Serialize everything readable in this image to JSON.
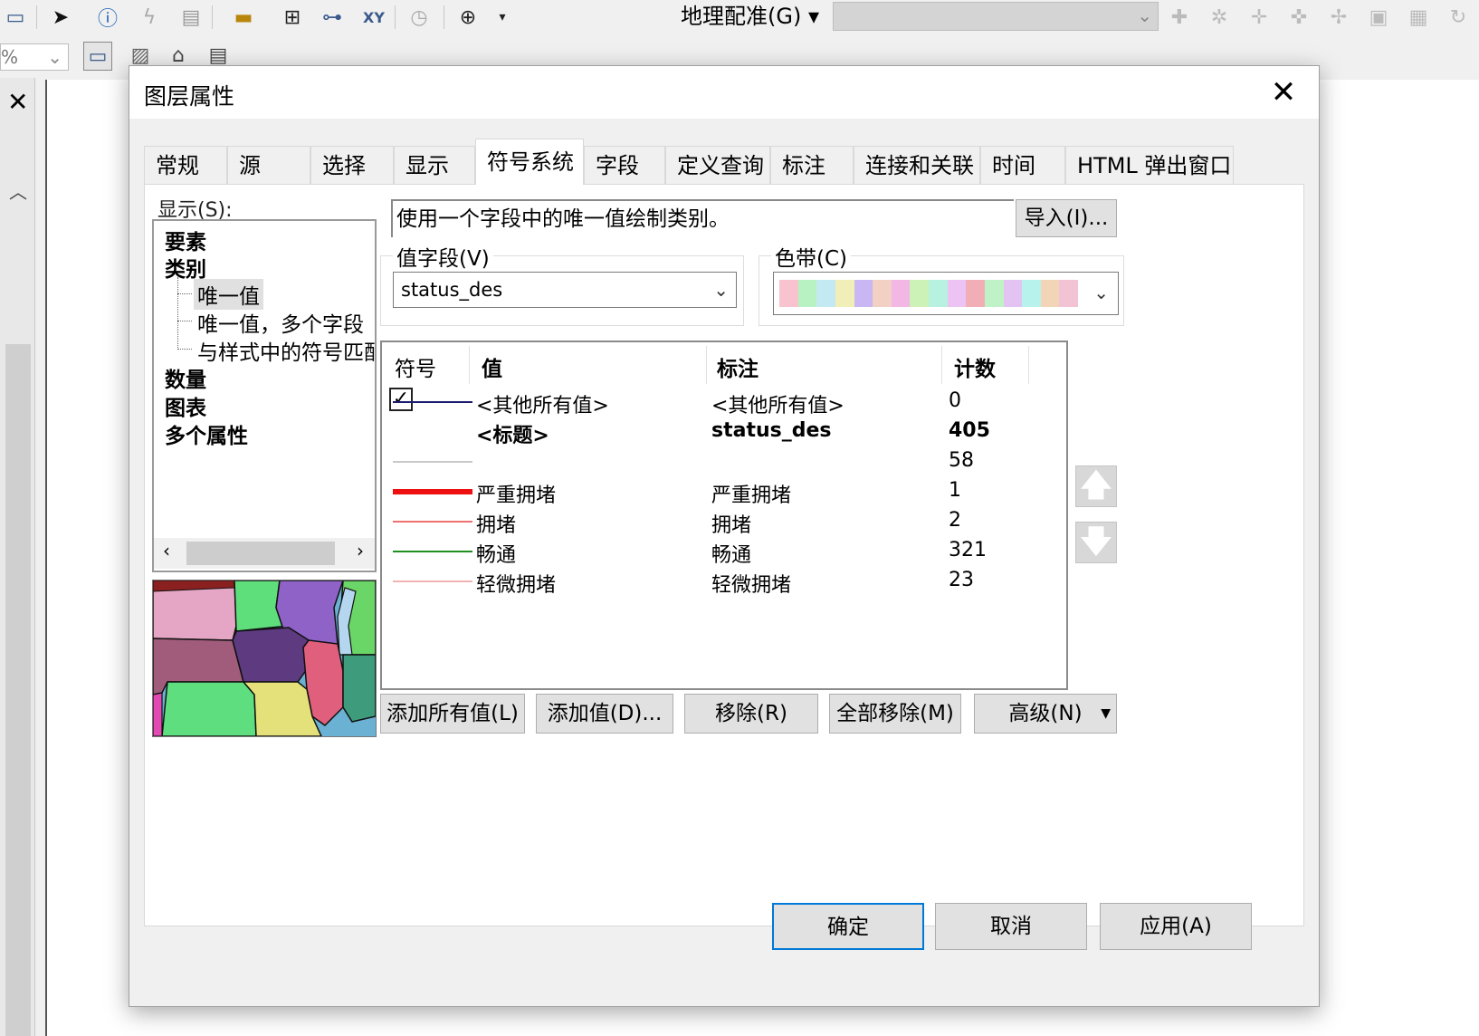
{
  "app": {
    "georef_menu": "地理配准(G) ▾",
    "zoom_percent": "%"
  },
  "dialog": {
    "title": "图层属性",
    "close_glyph": "✕",
    "tabs": [
      "常规",
      "源",
      "选择",
      "显示",
      "符号系统",
      "字段",
      "定义查询",
      "标注",
      "连接和关联",
      "时间",
      "HTML 弹出窗口"
    ],
    "active_tab": "符号系统",
    "show_label": "显示(S):",
    "tree": {
      "features": "要素",
      "categories": "类别",
      "unique_values": "唯一值",
      "unique_values_many": "唯一值，多个字段",
      "match_style": "与样式中的符号匹配",
      "quantities": "数量",
      "charts": "图表",
      "multiple_attributes": "多个属性"
    },
    "description": "使用一个字段中的唯一值绘制类别。",
    "import_button": "导入(I)...",
    "value_field": {
      "label": "值字段(V)",
      "selected": "status_des"
    },
    "color_ramp": {
      "label": "色带(C)",
      "colors": [
        "#f9c2cf",
        "#b8f2c3",
        "#c3eaf2",
        "#f2eeb7",
        "#c8b7f2",
        "#f2d0c3",
        "#f2b7e4",
        "#cdf2b7",
        "#b7f2e0",
        "#ecc3f2",
        "#f2aeb7",
        "#bff2c6",
        "#e2c3f2",
        "#b7f2ec",
        "#f2d4b7",
        "#f2c3d4"
      ]
    },
    "table": {
      "headers": {
        "symbol": "符号",
        "value": "值",
        "label": "标注",
        "count": "计数"
      },
      "rows": [
        {
          "value": "<其他所有值>",
          "label": "<其他所有值>",
          "count": "0",
          "line_color": "#1c1c6e",
          "line_width": 2
        },
        {
          "value": "<标题>",
          "label": "status_des",
          "count": "405",
          "bold": true
        },
        {
          "value": "",
          "label": "",
          "count": "58",
          "line_color": "#c8c8c8",
          "line_width": 2
        },
        {
          "value": "严重拥堵",
          "label": "严重拥堵",
          "count": "1",
          "line_color": "#ee1010",
          "line_width": 6
        },
        {
          "value": "拥堵",
          "label": "拥堵",
          "count": "2",
          "line_color": "#f07070",
          "line_width": 2
        },
        {
          "value": "畅通",
          "label": "畅通",
          "count": "321",
          "line_color": "#1f8f1f",
          "line_width": 2
        },
        {
          "value": "轻微拥堵",
          "label": "轻微拥堵",
          "count": "23",
          "line_color": "#f2b3b3",
          "line_width": 2
        }
      ]
    },
    "move_up_glyph": "🡅",
    "move_down_glyph": "🡇",
    "buttons": {
      "add_all": "添加所有值(L)",
      "add": "添加值(D)...",
      "remove": "移除(R)",
      "remove_all": "全部移除(M)",
      "advanced": "高级(N)"
    },
    "footer": {
      "ok": "确定",
      "cancel": "取消",
      "apply": "应用(A)"
    }
  }
}
